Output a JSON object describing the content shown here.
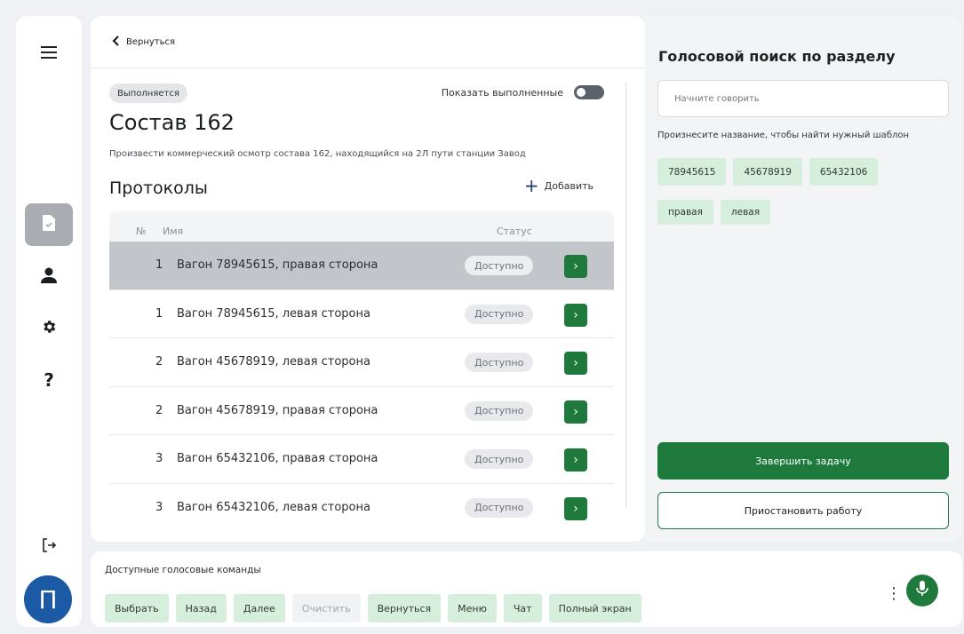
{
  "sidebar": {
    "menu_icon": "hamburger-icon",
    "items": [
      {
        "icon": "document-check-icon",
        "active": true
      },
      {
        "icon": "user-icon",
        "active": false
      },
      {
        "icon": "gear-icon",
        "active": false
      },
      {
        "icon": "help-icon",
        "active": false
      }
    ],
    "help_glyph": "?",
    "logout_icon": "logout-icon",
    "avatar_letter": "П",
    "avatar_color": "#1c5aa6"
  },
  "main": {
    "back_label": "Вернуться",
    "status_label": "Выполняется",
    "show_done_label": "Показать выполненные",
    "title": "Состав 162",
    "description": "Произвести коммерческий осмотр состава 162, находящийся на 2Л пути станции Завод",
    "section_title": "Протоколы",
    "add_label": "Добавить",
    "table": {
      "headers": {
        "num": "№",
        "name": "Имя",
        "status": "Статус"
      },
      "rows": [
        {
          "num": "1",
          "name": "Вагон 78945615, правая сторона",
          "status": "Доступно",
          "selected": true
        },
        {
          "num": "1",
          "name": "Вагон 78945615, левая сторона",
          "status": "Доступно",
          "selected": false
        },
        {
          "num": "2",
          "name": "Вагон 45678919, левая сторона",
          "status": "Доступно",
          "selected": false
        },
        {
          "num": "2",
          "name": "Вагон 45678919, правая сторона",
          "status": "Доступно",
          "selected": false
        },
        {
          "num": "3",
          "name": "Вагон 65432106, правая сторона",
          "status": "Доступно",
          "selected": false
        },
        {
          "num": "3",
          "name": "Вагон 65432106, левая сторона",
          "status": "Доступно",
          "selected": false
        }
      ]
    }
  },
  "voice_search": {
    "title": "Голосовой поиск по разделу",
    "placeholder": "Начните говорить",
    "hint": "Произнесите название, чтобы найти нужный шаблон",
    "chips": [
      "78945615",
      "45678919",
      "65432106",
      "правая",
      "левая"
    ],
    "finish_label": "Завершить задачу",
    "pause_label": "Приостановить работу"
  },
  "voice_commands": {
    "label": "Доступные голосовые команды",
    "commands": [
      {
        "label": "Выбрать",
        "enabled": true
      },
      {
        "label": "Назад",
        "enabled": true
      },
      {
        "label": "Далее",
        "enabled": true
      },
      {
        "label": "Очистить",
        "enabled": false
      },
      {
        "label": "Вернуться",
        "enabled": true
      },
      {
        "label": "Меню",
        "enabled": true
      },
      {
        "label": "Чат",
        "enabled": true
      },
      {
        "label": "Полный экран",
        "enabled": true
      }
    ],
    "more_icon": "more-vertical-icon",
    "mic_icon": "microphone-icon"
  },
  "colors": {
    "accent": "#1e7a3c",
    "chip_bg": "#d6efdc",
    "selected_row": "#c2c5c9"
  }
}
